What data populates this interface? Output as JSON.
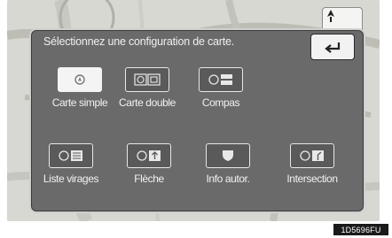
{
  "dialog": {
    "title": "Sélectionnez une configuration de carte."
  },
  "options": [
    {
      "label": "Carte simple",
      "icon": "single-map-icon",
      "active": true
    },
    {
      "label": "Carte double",
      "icon": "dual-map-icon",
      "active": false
    },
    {
      "label": "Compas",
      "icon": "compass-mode-icon",
      "active": false
    },
    {
      "label": "Liste virages",
      "icon": "turn-list-icon",
      "active": false
    },
    {
      "label": "Flèche",
      "icon": "arrow-mode-icon",
      "active": false
    },
    {
      "label": "Info autor.",
      "icon": "freeway-info-icon",
      "active": false
    },
    {
      "label": "Intersection",
      "icon": "intersection-icon",
      "active": false
    }
  ],
  "footer": {
    "reference_code": "1D5696FU"
  },
  "colors": {
    "dialog_bg": "#6a6a6a",
    "active_button": "#f4f4f4",
    "text": "#f2f2f2"
  }
}
